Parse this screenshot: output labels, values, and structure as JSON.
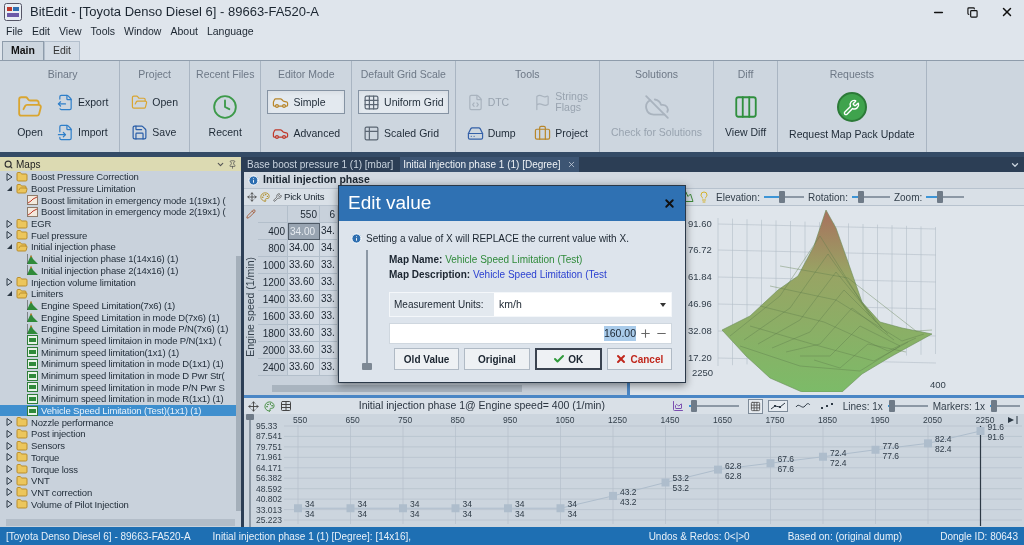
{
  "window": {
    "title": "BitEdit - [Toyota Denso Diesel 6] - 89663-FA520-A"
  },
  "menu": [
    "File",
    "Edit",
    "View",
    "Tools",
    "Window",
    "About",
    "Language"
  ],
  "ribbon_tabs": [
    {
      "label": "Main",
      "selected": true
    },
    {
      "label": "Edit",
      "selected": false
    }
  ],
  "ribbon_groups": [
    {
      "title": "Binary",
      "buttons": [
        {
          "label": "Open",
          "kind": "large",
          "selected": false,
          "disabled": false
        },
        {
          "label": "Export",
          "kind": "small",
          "selected": false,
          "disabled": false
        },
        {
          "label": "Import",
          "kind": "small",
          "selected": false,
          "disabled": false
        }
      ]
    },
    {
      "title": "Project",
      "buttons": [
        {
          "label": "Open",
          "kind": "small",
          "selected": false,
          "disabled": false
        },
        {
          "label": "Save",
          "kind": "small",
          "selected": false,
          "disabled": false
        }
      ]
    },
    {
      "title": "Recent Files",
      "buttons": [
        {
          "label": "Recent",
          "kind": "large",
          "selected": false,
          "disabled": false
        }
      ]
    },
    {
      "title": "Editor Mode",
      "buttons": [
        {
          "label": "Simple",
          "kind": "small",
          "selected": true,
          "disabled": false
        },
        {
          "label": "Advanced",
          "kind": "small",
          "selected": false,
          "disabled": false
        }
      ]
    },
    {
      "title": "Default Grid Scale",
      "buttons": [
        {
          "label": "Uniform Grid",
          "kind": "small",
          "selected": true,
          "disabled": false
        },
        {
          "label": "Scaled Grid",
          "kind": "small",
          "selected": false,
          "disabled": false
        }
      ]
    },
    {
      "title": "Tools",
      "buttons": [
        {
          "label": "DTC",
          "kind": "small",
          "selected": false,
          "disabled": true
        },
        {
          "label": "Strings\nFlags",
          "kind": "small",
          "selected": false,
          "disabled": true
        },
        {
          "label": "Dump",
          "kind": "small",
          "selected": false,
          "disabled": false
        },
        {
          "label": "Project",
          "kind": "small",
          "selected": false,
          "disabled": false
        }
      ]
    },
    {
      "title": "Solutions",
      "buttons": [
        {
          "label": "Check for Solutions",
          "kind": "large",
          "selected": false,
          "disabled": true
        }
      ]
    },
    {
      "title": "Diff",
      "buttons": [
        {
          "label": "View Diff",
          "kind": "large",
          "selected": false,
          "disabled": false
        }
      ]
    },
    {
      "title": "Requests",
      "buttons": [
        {
          "label": "Request Map Pack Update",
          "kind": "large",
          "selected": false,
          "disabled": false
        }
      ]
    }
  ],
  "maps_panel": {
    "title": "Maps",
    "items": [
      {
        "label": "Boost Pressure Correction",
        "kind": "folder",
        "expanded": false,
        "selected": false
      },
      {
        "label": "Boost Pressure Limitation",
        "kind": "folder",
        "expanded": true,
        "selected": false,
        "children": [
          {
            "label": "Boost limitation in emergency mode 1(19x1) (",
            "kind": "map_2d",
            "selected": false
          },
          {
            "label": "Boost limitation in emergency mode 2(19x1) (",
            "kind": "map_2d",
            "selected": false
          }
        ]
      },
      {
        "label": "EGR",
        "kind": "folder",
        "expanded": false,
        "selected": false
      },
      {
        "label": "Fuel pressure",
        "kind": "folder",
        "expanded": false,
        "selected": false
      },
      {
        "label": "Initial injection phase",
        "kind": "folder",
        "expanded": true,
        "selected": false,
        "children": [
          {
            "label": "Initial injection phase 1(14x16) (1)",
            "kind": "map_3d",
            "selected": false
          },
          {
            "label": "Initial injection phase 2(14x16) (1)",
            "kind": "map_3d",
            "selected": false
          }
        ]
      },
      {
        "label": "Injection volume limitation",
        "kind": "folder",
        "expanded": false,
        "selected": false
      },
      {
        "label": "Limiters",
        "kind": "folder",
        "expanded": true,
        "selected": false,
        "children": [
          {
            "label": "Engine Speed Limitation(7x6) (1)",
            "kind": "map_3d",
            "selected": false
          },
          {
            "label": "Engine Speed Limitation in mode D(7x6) (1)",
            "kind": "map_3d",
            "selected": false
          },
          {
            "label": "Engine Speed Limitation in mode P/N(7x6) (1)",
            "kind": "map_3d",
            "selected": false
          },
          {
            "label": "Minimum speed limitaion in mode P/N(1x1) (",
            "kind": "value",
            "selected": false
          },
          {
            "label": "Minimum speed limitation(1x1) (1)",
            "kind": "value",
            "selected": false
          },
          {
            "label": "Minimum speed limitation in mode D(1x1) (1)",
            "kind": "value",
            "selected": false
          },
          {
            "label": "Minimum speed limitation in mode D Pwr Str(",
            "kind": "value",
            "selected": false
          },
          {
            "label": "Minimum speed limitation in mode P/N Pwr S",
            "kind": "value",
            "selected": false
          },
          {
            "label": "Minimum speed limitation in mode R(1x1) (1)",
            "kind": "value",
            "selected": false
          },
          {
            "label": "Vehicle Speed Limitation (Test)(1x1) (1)",
            "kind": "value",
            "selected": true
          }
        ]
      },
      {
        "label": "Nozzle performance",
        "kind": "folder",
        "expanded": false,
        "selected": false
      },
      {
        "label": "Post injection",
        "kind": "folder",
        "expanded": false,
        "selected": false
      },
      {
        "label": "Sensors",
        "kind": "folder",
        "expanded": false,
        "selected": false
      },
      {
        "label": "Torque",
        "kind": "folder",
        "expanded": false,
        "selected": false
      },
      {
        "label": "Torque loss",
        "kind": "folder",
        "expanded": false,
        "selected": false
      },
      {
        "label": "VNT",
        "kind": "folder",
        "expanded": false,
        "selected": false
      },
      {
        "label": "VNT correction",
        "kind": "folder",
        "expanded": false,
        "selected": false
      },
      {
        "label": "Volume of Pilot Injection",
        "kind": "folder",
        "expanded": false,
        "selected": false
      }
    ]
  },
  "document_tabs": [
    {
      "label": "Base boost pressure 1 (1) [mbar]",
      "selected": false
    },
    {
      "label": "Initial injection phase 1 (1) [Degree]",
      "selected": true
    }
  ],
  "editor": {
    "title": "Initial injection phase",
    "pick_units": "Pick Units",
    "grid": {
      "axis_label": "Engine speed (1/min)",
      "columns": [
        "550",
        "6"
      ],
      "rows": [
        {
          "label": "400",
          "cells": [
            {
              "text": "34.00",
              "selected": true
            },
            {
              "text": "34.",
              "selected": false
            }
          ]
        },
        {
          "label": "800",
          "cells": [
            {
              "text": "34.00",
              "selected": false
            },
            {
              "text": "34.",
              "selected": false
            }
          ]
        },
        {
          "label": "1000",
          "cells": [
            {
              "text": "33.60",
              "selected": false
            },
            {
              "text": "33.",
              "selected": false
            }
          ]
        },
        {
          "label": "1200",
          "cells": [
            {
              "text": "33.60",
              "selected": false
            },
            {
              "text": "33.",
              "selected": false
            }
          ]
        },
        {
          "label": "1400",
          "cells": [
            {
              "text": "33.60",
              "selected": false
            },
            {
              "text": "33.",
              "selected": false
            }
          ]
        },
        {
          "label": "1600",
          "cells": [
            {
              "text": "33.60",
              "selected": false
            },
            {
              "text": "33.",
              "selected": false
            }
          ]
        },
        {
          "label": "1800",
          "cells": [
            {
              "text": "33.60",
              "selected": false
            },
            {
              "text": "33.",
              "selected": false
            }
          ]
        },
        {
          "label": "2000",
          "cells": [
            {
              "text": "33.60",
              "selected": false
            },
            {
              "text": "33.",
              "selected": false
            }
          ]
        },
        {
          "label": "2400",
          "cells": [
            {
              "text": "33.60",
              "selected": false
            },
            {
              "text": "33.",
              "selected": false
            }
          ]
        }
      ]
    },
    "surface": {
      "elevation": {
        "label": "Elevation:",
        "level": 0.45
      },
      "rotation": {
        "label": "Rotation:",
        "level": 0.2
      },
      "zoom": {
        "label": "Zoom:",
        "level": 0.35
      },
      "z_ticks": [
        "91.60",
        "76.72",
        "61.84",
        "46.96",
        "32.08",
        "17.20"
      ],
      "axis_labels": [
        "2250",
        "400"
      ]
    }
  },
  "line_view": {
    "title": "Initial injection phase 1@ Engine speed= 400 (1/min)",
    "scale": {
      "level": 0.05
    },
    "y_slider": {
      "level": 1
    },
    "styles": [
      {
        "kind": "line_markers",
        "selected": true
      },
      {
        "kind": "line",
        "selected": false
      },
      {
        "kind": "markers",
        "selected": false
      }
    ],
    "lines": {
      "label": "Lines: 1x",
      "level": 0.05
    },
    "markers": {
      "label": "Markers: 1x",
      "level": 0.05
    },
    "chart_data": {
      "type": "line",
      "categories": [
        "550",
        "650",
        "750",
        "850",
        "950",
        "1050",
        "1250",
        "1450",
        "1650",
        "1750",
        "1850",
        "1950",
        "2050",
        "2250"
      ],
      "series": [
        {
          "color": "#aebdcc",
          "marker": "square",
          "values": [
            34,
            34,
            34,
            34,
            34,
            34,
            43.2,
            53.2,
            62.8,
            67.6,
            72.4,
            77.6,
            82.4,
            91.6
          ]
        }
      ],
      "annotations": [
        {
          "x": "550",
          "y": 34,
          "text": "34"
        },
        {
          "x": "650",
          "y": 34,
          "text": "34"
        },
        {
          "x": "750",
          "y": 34,
          "text": "34"
        },
        {
          "x": "850",
          "y": 34,
          "text": "34"
        },
        {
          "x": "950",
          "y": 34,
          "text": "34"
        },
        {
          "x": "1050",
          "y": 34,
          "text": "34"
        },
        {
          "x": "1250",
          "y": 43.2,
          "text": "43.2"
        },
        {
          "x": "1450",
          "y": 53.2,
          "text": "53.2"
        },
        {
          "x": "1650",
          "y": 62.8,
          "text": "62.8"
        },
        {
          "x": "1750",
          "y": 67.6,
          "text": "67.6"
        },
        {
          "x": "1850",
          "y": 72.4,
          "text": "72.4"
        },
        {
          "x": "1950",
          "y": 77.6,
          "text": "77.6"
        },
        {
          "x": "2050",
          "y": 82.4,
          "text": "82.4"
        },
        {
          "x": "2250",
          "y": 91.6,
          "text": "91.6"
        }
      ],
      "ylim": [
        25.223,
        95.33
      ],
      "yticks": [
        95.33,
        87.541,
        79.751,
        71.961,
        64.171,
        56.382,
        48.592,
        40.802,
        33.013,
        25.223
      ],
      "grid": true,
      "data_labels": true,
      "ref_lines": [
        {
          "axis": "x",
          "value": "2250",
          "color": "#2d3945"
        }
      ]
    }
  },
  "dialog": {
    "title": "Edit value",
    "info": "Setting a value of X will REPLACE the current value with X.",
    "map_name_label": "Map Name:",
    "map_name": "Vehicle Speed Limitation (Test)",
    "map_description_label": "Map Description:",
    "map_description": "Vehicle Speed Limitation (Test",
    "units_label": "Measurement Units:",
    "units": "km/h",
    "value": "160.00",
    "slider": {
      "level": 0
    },
    "buttons": [
      {
        "label": "Old Value",
        "kind": "plain",
        "focused": false
      },
      {
        "label": "Original",
        "kind": "plain",
        "focused": false
      },
      {
        "label": "OK",
        "kind": "ok",
        "focused": true
      },
      {
        "label": "Cancel",
        "kind": "cancel",
        "focused": false
      }
    ]
  },
  "status_bar": {
    "left": [
      "[Toyota Denso Diesel 6] - 89663-FA520-A",
      "Initial injection phase 1 (1) [Degree]: [14x16],"
    ],
    "right": [
      "Undos & Redos: 0<|>0",
      "Based on: (original dump)",
      "Dongle ID: 80643"
    ]
  }
}
